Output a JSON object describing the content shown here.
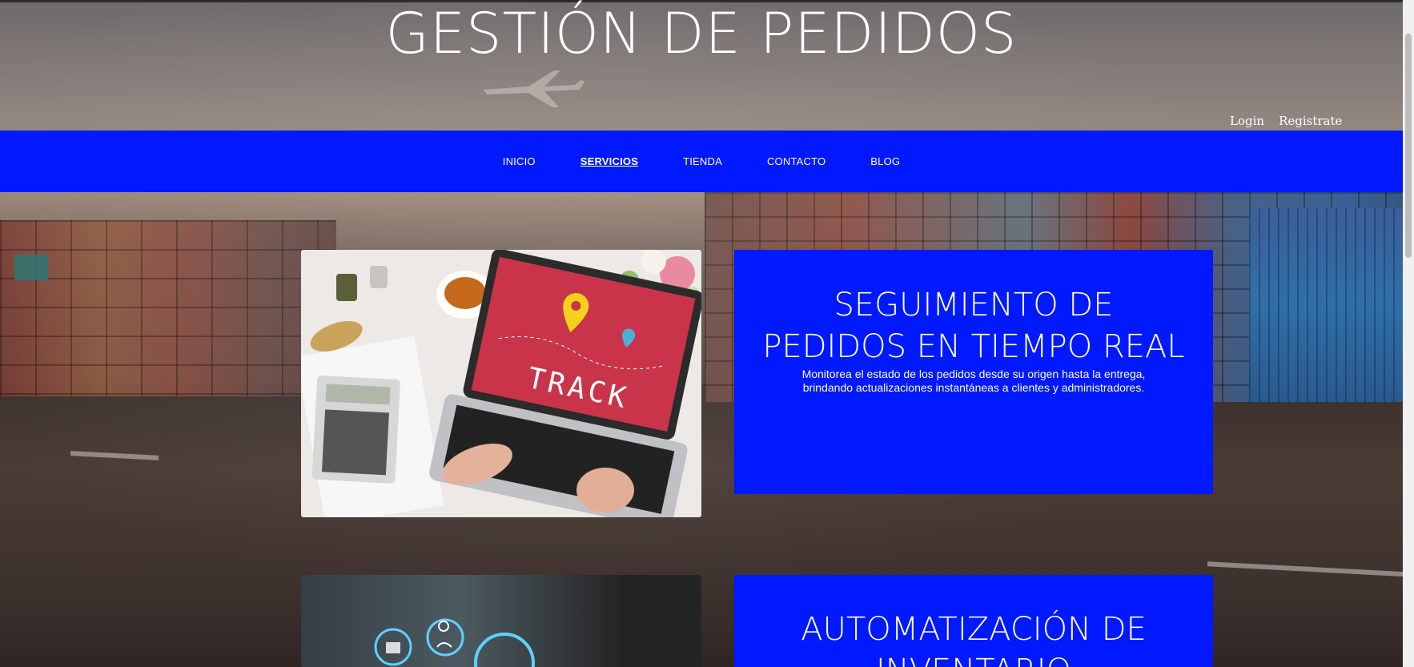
{
  "header": {
    "title": "GESTIÓN DE PEDIDOS",
    "auth": {
      "login": "Login",
      "register": "Registrate"
    }
  },
  "nav": {
    "items": [
      {
        "label": "INICIO",
        "active": false
      },
      {
        "label": "SERVICIOS",
        "active": true
      },
      {
        "label": "TIENDA",
        "active": false
      },
      {
        "label": "CONTACTO",
        "active": false
      },
      {
        "label": "BLOG",
        "active": false
      }
    ]
  },
  "services": [
    {
      "title": "SEGUIMIENTO DE PEDIDOS EN TIEMPO REAL",
      "description": "Monitorea el estado de los pedidos desde su origen hasta la entrega, brindando actualizaciones instantáneas a clientes y administradores.",
      "image_text": "TRACK"
    },
    {
      "title": "AUTOMATIZACIÓN DE INVENTARIO",
      "description": ""
    }
  ],
  "colors": {
    "nav_background": "#0019ff",
    "card_background": "#0019ff",
    "track_screen": "#c9344a",
    "pin_yellow": "#f4d21c"
  }
}
